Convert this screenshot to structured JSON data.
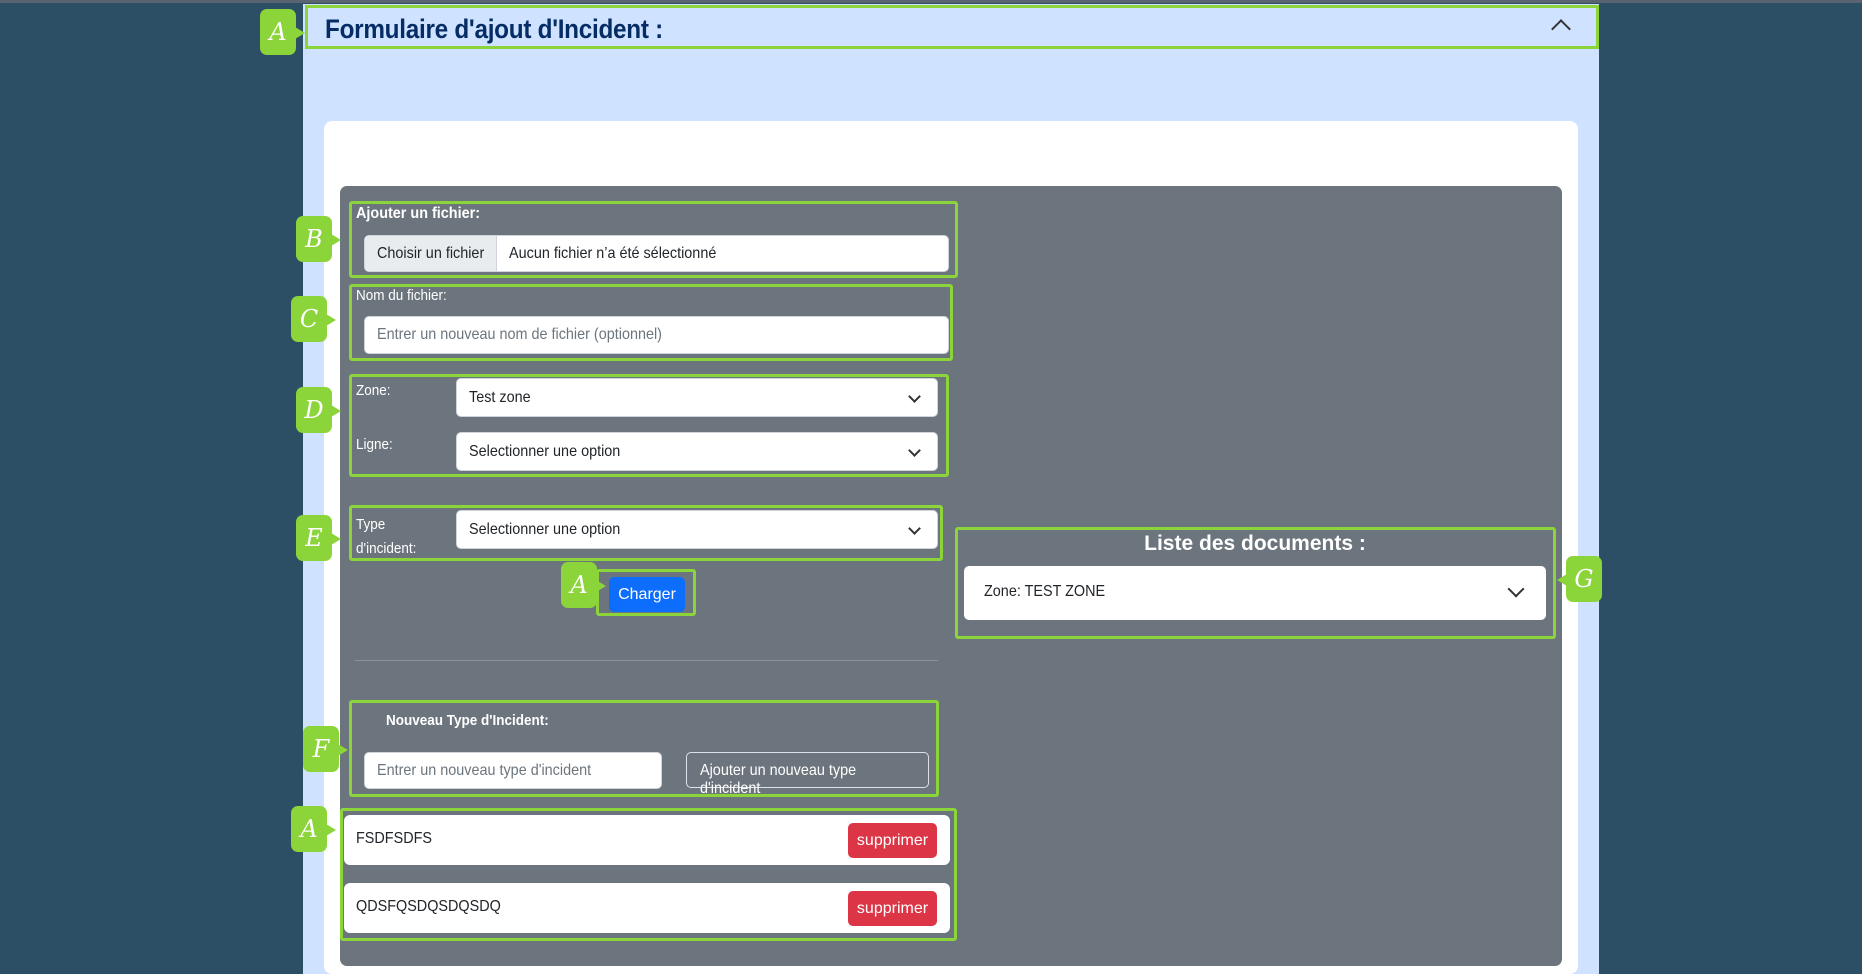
{
  "header": {
    "title": "Formulaire d'ajout d'Incident :"
  },
  "tags": {
    "a": "A",
    "b": "B",
    "c": "C",
    "d": "D",
    "e": "E",
    "f": "F",
    "g": "G"
  },
  "file_upload": {
    "label": "Ajouter un fichier:",
    "button_label": "Choisir un fichier",
    "status_text": "Aucun fichier n’a été sélectionné"
  },
  "file_name": {
    "label": "Nom du fichier:",
    "placeholder": "Entrer un nouveau nom de fichier (optionnel)"
  },
  "zone": {
    "label": "Zone:",
    "selected": "Test zone"
  },
  "ligne": {
    "label": "Ligne:",
    "selected": "Selectionner une option"
  },
  "type_incident": {
    "label_line1": "Type",
    "label_line2": "d'incident:",
    "selected": "Selectionner une option"
  },
  "charger_button": "Charger",
  "new_type": {
    "label": "Nouveau Type d'Incident:",
    "placeholder": "Entrer un nouveau type d'incident",
    "add_button": "Ajouter un nouveau type d'incident"
  },
  "incident_types": [
    {
      "name": "FSDFSDFS",
      "delete_label": "supprimer"
    },
    {
      "name": "QDSFQSDQSDQSDQ",
      "delete_label": "supprimer"
    }
  ],
  "documents": {
    "title": "Liste des documents :",
    "zone_selected": "Zone: TEST ZONE"
  },
  "colors": {
    "highlight": "#8bd43a",
    "primary": "#0d6efd",
    "danger": "#dc3545",
    "panel_bg": "#cfe2ff",
    "page_bg": "#2c4f66",
    "form_bg": "#6c757d"
  }
}
